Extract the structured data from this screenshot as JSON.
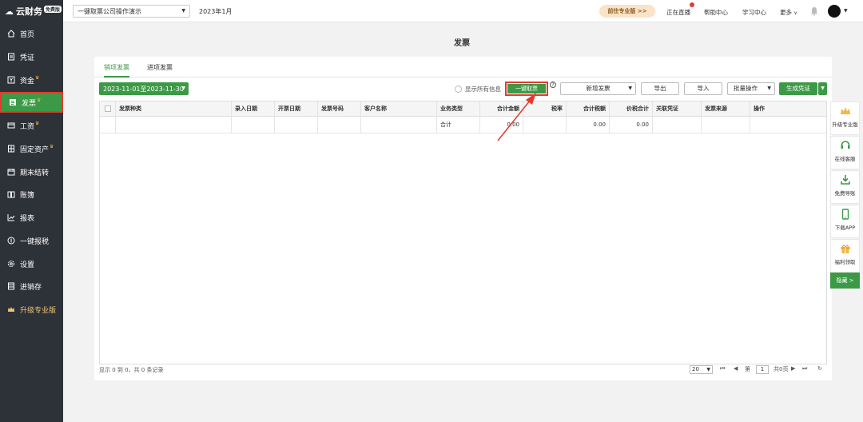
{
  "brand": {
    "name": "云财务",
    "badge": "免费版"
  },
  "sidebar": {
    "items": [
      {
        "label": "首页",
        "icon": "home-icon"
      },
      {
        "label": "凭证",
        "icon": "voucher-icon"
      },
      {
        "label": "资金",
        "icon": "fund-icon",
        "crown": "♛"
      },
      {
        "label": "发票",
        "icon": "invoice-icon",
        "crown": "♛"
      },
      {
        "label": "工资",
        "icon": "salary-icon",
        "crown": "♛"
      },
      {
        "label": "固定资产",
        "icon": "asset-icon",
        "crown": "♛"
      },
      {
        "label": "期末结转",
        "icon": "calendar-icon"
      },
      {
        "label": "账簿",
        "icon": "book-icon"
      },
      {
        "label": "报表",
        "icon": "chart-icon"
      },
      {
        "label": "一键报税",
        "icon": "tax-icon"
      },
      {
        "label": "设置",
        "icon": "gear-icon"
      },
      {
        "label": "进销存",
        "icon": "inventory-icon"
      },
      {
        "label": "升级专业版",
        "icon": "crown-icon"
      }
    ]
  },
  "topbar": {
    "company": "一键取票公司操作演示",
    "period": "2023年1月",
    "promo": "前往专业版 >>",
    "live": "正在直播",
    "help": "帮助中心",
    "learn": "学习中心",
    "more": "更多"
  },
  "page": {
    "title": "发票"
  },
  "tabs": [
    "销项发票",
    "进项发票"
  ],
  "toolbar": {
    "date_range": "2023-11-01至2023-11-30",
    "show_all": "显示所有信息",
    "one_key": "一键取票",
    "new_invoice": "新增发票",
    "export": "导出",
    "import": "导入",
    "batch": "批量操作",
    "gen_voucher": "生成凭证"
  },
  "table": {
    "headers": [
      "发票种类",
      "录入日期",
      "开票日期",
      "发票号码",
      "客户名称",
      "业务类型",
      "合计金额",
      "税率",
      "合计税额",
      "价税合计",
      "关联凭证",
      "发票来源",
      "操作"
    ],
    "total_row": {
      "label": "合计",
      "amount": "0.00",
      "tax": "0.00",
      "total": "0.00"
    }
  },
  "footer": {
    "info": "显示 0 到 0，共 0 条记录",
    "page_size": "20",
    "page_prefix": "第",
    "page": "1",
    "page_suffix": "共0页"
  },
  "rightbar": {
    "items": [
      "升级专业版",
      "在线客服",
      "免费导账",
      "下载APP",
      "福利领取"
    ],
    "hide": "隐藏 >"
  },
  "colors": {
    "green": "#3c9a46",
    "sidebar": "#2d3138",
    "highlight": "#e23b2e"
  }
}
